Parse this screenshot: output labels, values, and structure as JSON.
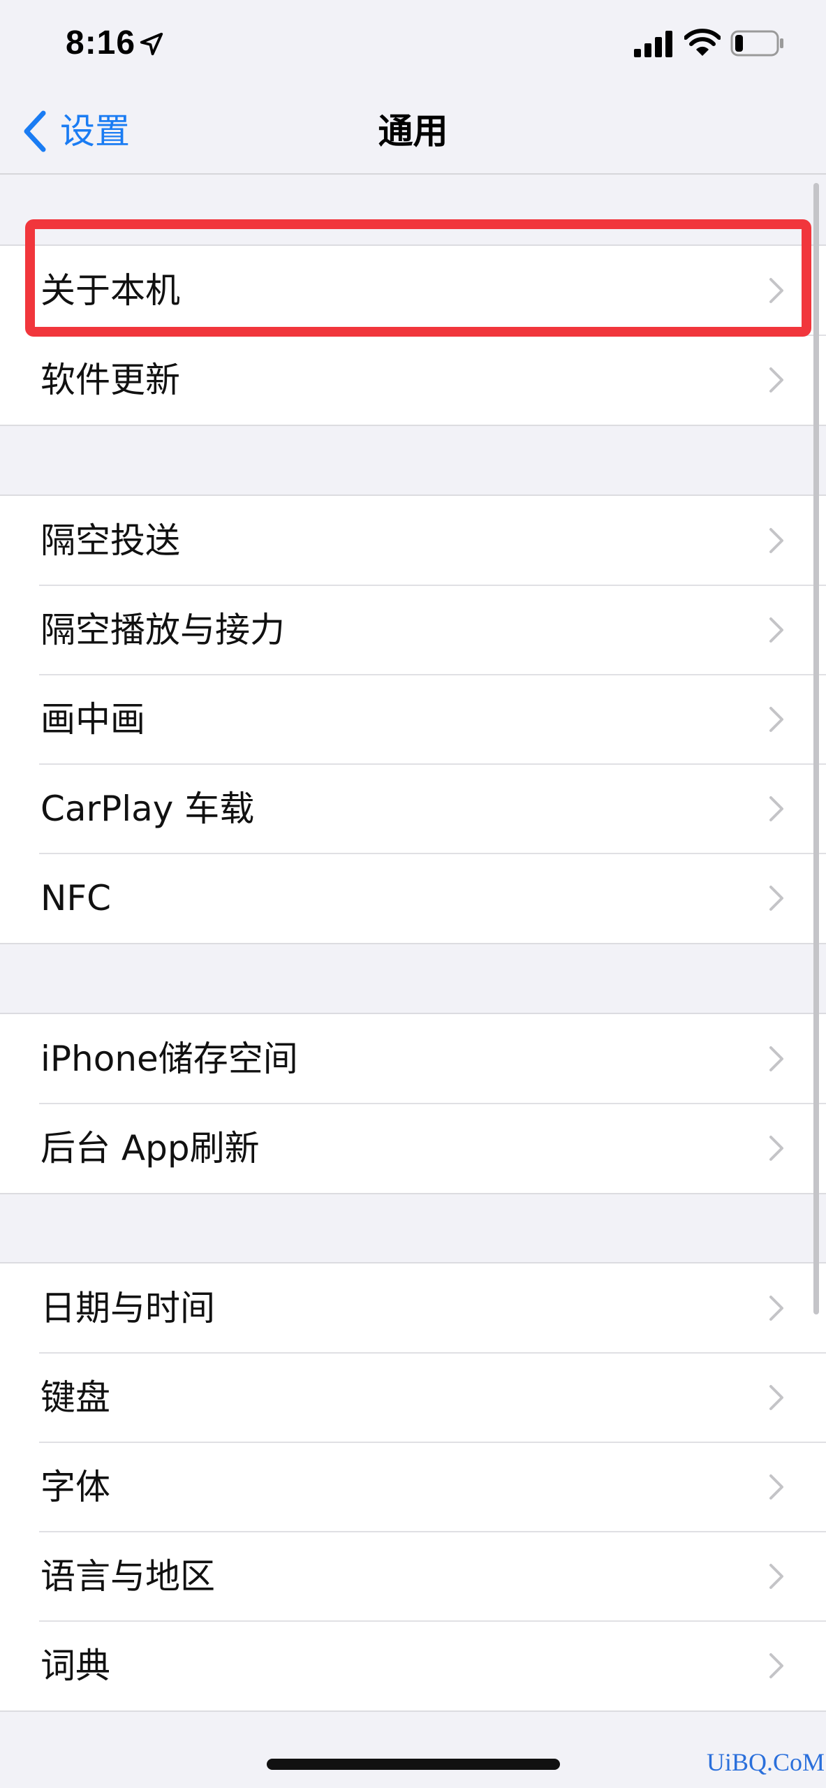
{
  "status_bar": {
    "time": "8:16",
    "icons": [
      "location-arrow-icon",
      "cellular-signal-icon",
      "wifi-icon",
      "battery-icon"
    ],
    "battery_level": 0.2
  },
  "nav": {
    "back_label": "设置",
    "title": "通用",
    "accent_color": "#1a7cf3"
  },
  "groups": [
    {
      "items": [
        {
          "label": "关于本机",
          "highlighted": true
        },
        {
          "label": "软件更新"
        }
      ]
    },
    {
      "items": [
        {
          "label": "隔空投送"
        },
        {
          "label": "隔空播放与接力"
        },
        {
          "label": "画中画"
        },
        {
          "label": "CarPlay 车载"
        },
        {
          "label": "NFC"
        }
      ]
    },
    {
      "items": [
        {
          "label": "iPhone储存空间"
        },
        {
          "label": "后台 App刷新"
        }
      ]
    },
    {
      "items": [
        {
          "label": "日期与时间"
        },
        {
          "label": "键盘"
        },
        {
          "label": "字体"
        },
        {
          "label": "语言与地区"
        },
        {
          "label": "词典"
        }
      ]
    }
  ],
  "highlight_color": "#f1363c",
  "watermark": "UiBQ.CoM"
}
